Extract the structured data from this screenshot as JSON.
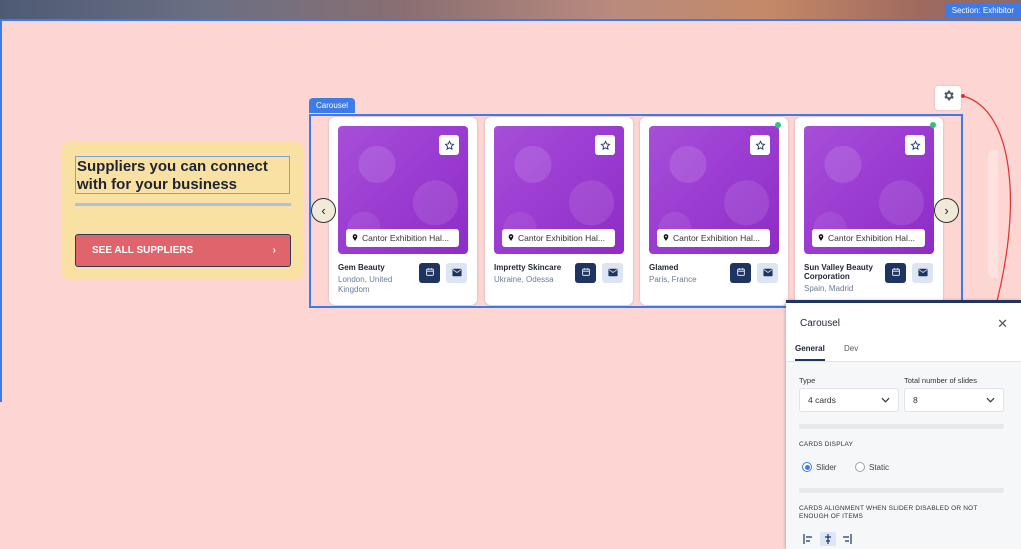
{
  "section": {
    "label": "Section: Exhibitor"
  },
  "left": {
    "heading": "Suppliers you can connect with for your business",
    "cta": "SEE ALL SUPPLIERS"
  },
  "carousel": {
    "tag": "Carousel",
    "cards": [
      {
        "name": "Gem Beauty",
        "place": "London, United Kingdom",
        "location": "Cantor Exhibition Hal...",
        "status_dot": false
      },
      {
        "name": "Impretty Skincare",
        "place": "Ukraine, Odessa",
        "location": "Cantor Exhibition Hal...",
        "status_dot": false
      },
      {
        "name": "Glamed",
        "place": "Paris, France",
        "location": "Cantor Exhibition Hal...",
        "status_dot": true
      },
      {
        "name": "Sun Valley Beauty Corporation",
        "place": "Spain, Madrid",
        "location": "Cantor Exhibition Hal...",
        "status_dot": true
      }
    ]
  },
  "panel": {
    "title": "Carousel",
    "tabs": [
      "General",
      "Dev"
    ],
    "type_label": "Type",
    "type_value": "4 cards",
    "total_label": "Total number of slides",
    "total_value": "8",
    "cards_display": "CARDS DISPLAY",
    "radio_slider": "Slider",
    "radio_static": "Static",
    "alignment": "CARDS ALIGNMENT WHEN SLIDER DISABLED OR NOT ENOUGH OF ITEMS"
  },
  "colors": {
    "accent": "#3d7be8",
    "navy": "#1f3561",
    "cta": "#e0646b",
    "card_bg": "#f9e1a3"
  }
}
